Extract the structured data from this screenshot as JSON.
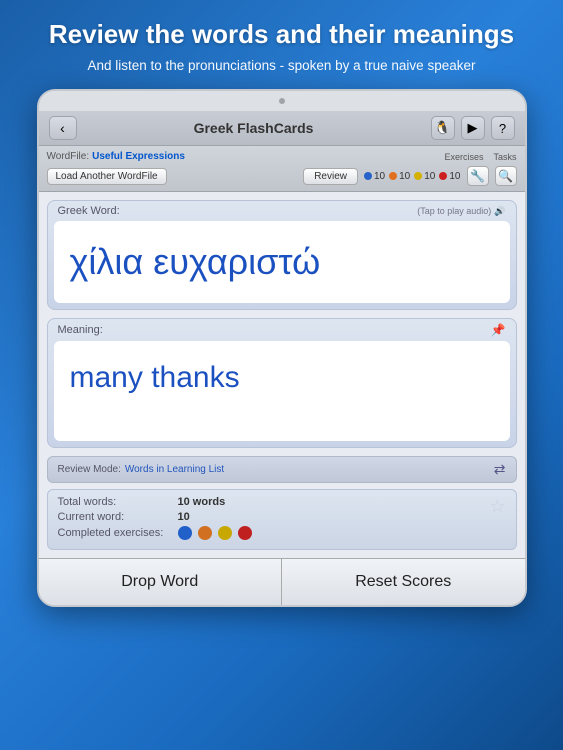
{
  "header": {
    "title": "Review the words and their meanings",
    "subtitle": "And listen to the pronunciations - spoken by a true naive speaker"
  },
  "nav": {
    "back_label": "‹",
    "title": "Greek FlashCards",
    "icons": [
      "🐧",
      "▶",
      "?"
    ]
  },
  "toolbar": {
    "wordfile_label": "WordFile:",
    "wordfile_name": "Useful Expressions",
    "load_btn_label": "Load Another WordFile",
    "exercises_label": "Exercises",
    "review_btn_label": "Review",
    "tasks_label": "Tasks",
    "score_blue": "10",
    "score_orange": "10",
    "score_yellow": "10",
    "score_red": "10"
  },
  "word_card": {
    "label": "Greek Word:",
    "tap_audio": "(Tap to play audio)",
    "word": "χίλια ευχαριστώ"
  },
  "meaning_card": {
    "label": "Meaning:",
    "meaning": "many thanks"
  },
  "review_mode": {
    "label": "Review Mode:",
    "value": "Words in Learning List"
  },
  "stats": {
    "total_words_label": "Total words:",
    "total_words_value": "10 words",
    "current_word_label": "Current word:",
    "current_word_value": "10",
    "completed_label": "Completed exercises:"
  },
  "buttons": {
    "drop_word": "Drop Word",
    "reset_scores": "Reset Scores"
  }
}
